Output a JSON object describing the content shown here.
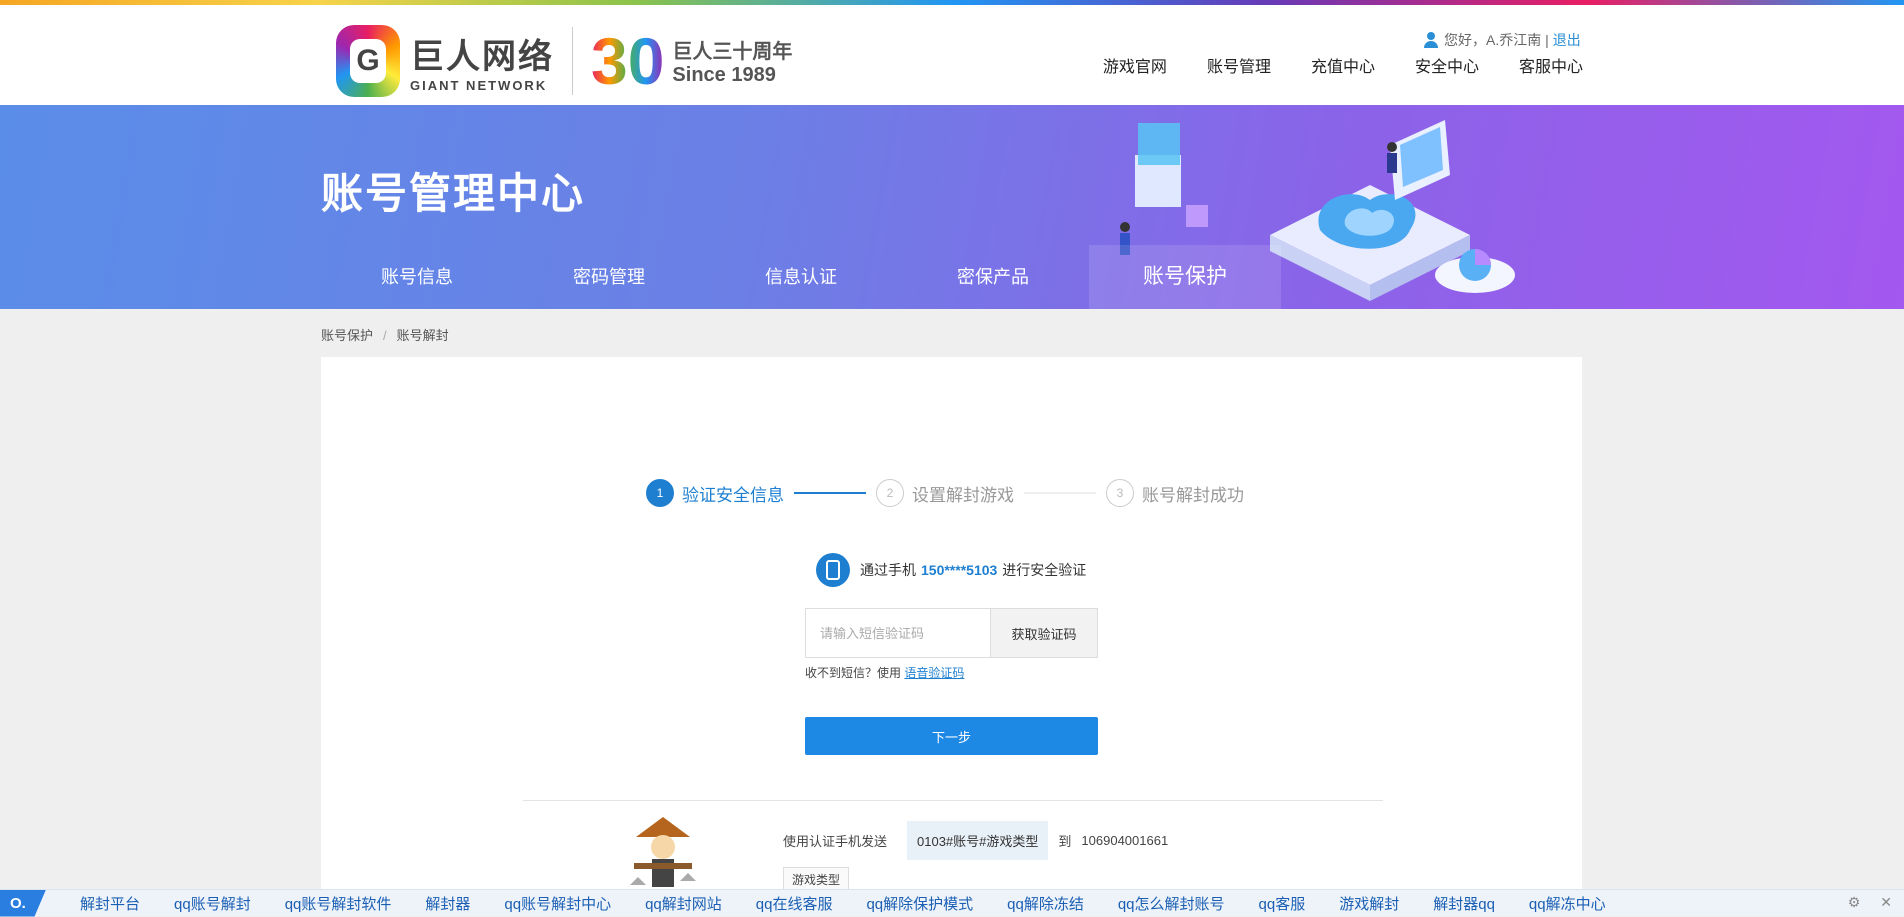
{
  "header": {
    "logo_cn": "巨人网络",
    "logo_en": "GIANT NETWORK",
    "anniversary_mark": "30",
    "anniversary_cn": "巨人三十周年",
    "anniversary_since": "Since 1989",
    "greeting": "您好，A.乔江南 |",
    "logout": "退出",
    "nav": [
      "游戏官网",
      "账号管理",
      "充值中心",
      "安全中心",
      "客服中心"
    ]
  },
  "banner": {
    "title": "账号管理中心",
    "tabs": [
      "账号信息",
      "密码管理",
      "信息认证",
      "密保产品",
      "账号保护"
    ],
    "active_tab": 4
  },
  "breadcrumb": [
    "账号保护",
    "/",
    "账号解封"
  ],
  "steps": [
    {
      "num": "1",
      "label": "验证安全信息"
    },
    {
      "num": "2",
      "label": "设置解封游戏"
    },
    {
      "num": "3",
      "label": "账号解封成功"
    }
  ],
  "verify": {
    "prefix": "通过手机",
    "phone": "150****5103",
    "suffix": "进行安全验证",
    "code_placeholder": "请输入短信验证码",
    "get_code": "获取验证码",
    "no_sms": "收不到短信？使用",
    "voice_code": "语音验证码",
    "next": "下一步"
  },
  "sms": {
    "send_text": "使用认证手机发送",
    "code": "0103#账号#游戏类型",
    "to": "到",
    "number": "106904001661",
    "tag": "游戏类型"
  },
  "bottombar": {
    "logo": "O.",
    "links": [
      "解封平台",
      "qq账号解封",
      "qq账号解封软件",
      "解封器",
      "qq账号解封中心",
      "qq解封网站",
      "qq在线客服",
      "qq解除保护模式",
      "qq解除冻结",
      "qq怎么解封账号",
      "qq客服",
      "游戏解封",
      "解封器qq",
      "qq解冻中心"
    ],
    "tools": [
      "⚙",
      "✕"
    ]
  },
  "colors": {
    "accent": "#1e7fd1",
    "button": "#1e88e5",
    "banner_start": "#5a8de8",
    "banner_end": "#a358ef"
  }
}
